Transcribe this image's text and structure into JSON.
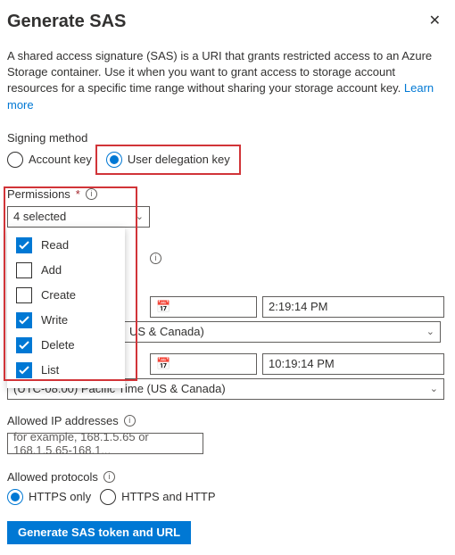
{
  "header": {
    "title": "Generate SAS"
  },
  "desc": {
    "text": "A shared access signature (SAS) is a URI that grants restricted access to an Azure Storage container. Use it when you want to grant access to storage account resources for a specific time range without sharing your storage account key. ",
    "learn_more": "Learn more"
  },
  "signing": {
    "label": "Signing method",
    "options": {
      "account_key": "Account key",
      "user_delegation": "User delegation key"
    },
    "selected": "user_delegation"
  },
  "permissions": {
    "label": "Permissions",
    "summary": "4 selected",
    "items": [
      {
        "label": "Read",
        "checked": true
      },
      {
        "label": "Add",
        "checked": false
      },
      {
        "label": "Create",
        "checked": false
      },
      {
        "label": "Write",
        "checked": true
      },
      {
        "label": "Delete",
        "checked": true
      },
      {
        "label": "List",
        "checked": true
      }
    ]
  },
  "start": {
    "time": "2:19:14 PM",
    "tz": "US & Canada)"
  },
  "expiry": {
    "time": "10:19:14 PM",
    "tz": "(UTC-08:00) Pacific Time (US & Canada)"
  },
  "ip": {
    "label": "Allowed IP addresses",
    "placeholder": "for example, 168.1.5.65 or 168.1.5.65-168.1..."
  },
  "protocols": {
    "label": "Allowed protocols",
    "options": {
      "https_only": "HTTPS only",
      "both": "HTTPS and HTTP"
    },
    "selected": "https_only"
  },
  "submit": {
    "label": "Generate SAS token and URL"
  }
}
